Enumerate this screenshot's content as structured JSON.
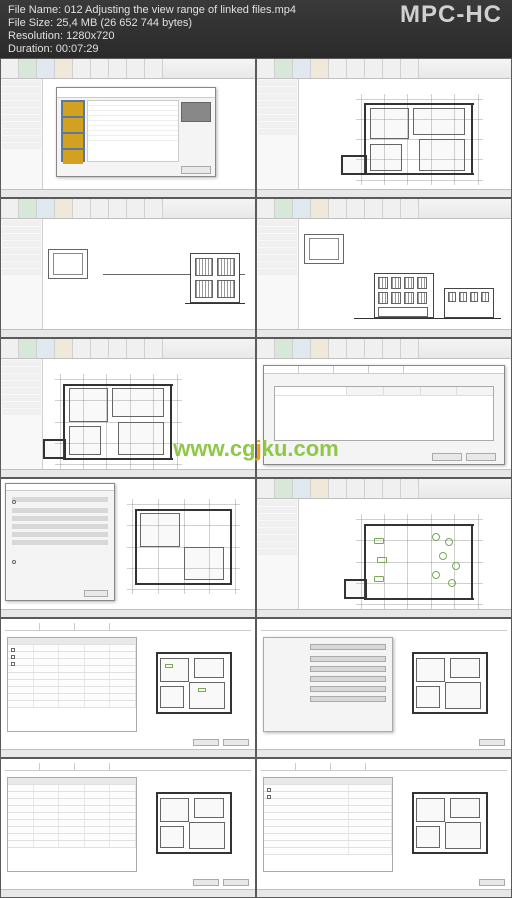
{
  "header": {
    "filename_label": "File Name:",
    "filename": "012 Adjusting the view range of linked files.mp4",
    "filesize_label": "File Size:",
    "filesize": "25,4 MB (26 652 744 bytes)",
    "resolution_label": "Resolution:",
    "resolution": "1280x720",
    "duration_label": "Duration:",
    "duration": "00:07:29",
    "brand": "MPC-HC"
  },
  "watermark": {
    "part1": "www.cg",
    "part2": "j",
    "part3": "ku.com"
  },
  "thumbs": {
    "count": 12,
    "descriptions": [
      "file-browser-dialog",
      "floor-plan-view",
      "section-view-with-plan",
      "elevation-view",
      "floor-plan-wireframe",
      "visibility-graphics-dialog",
      "visibility-graphics-with-plan",
      "floor-plan-furniture",
      "categories-table-with-plan",
      "filters-settings-with-plan",
      "override-table-with-plan",
      "categories-list-with-plan"
    ]
  }
}
